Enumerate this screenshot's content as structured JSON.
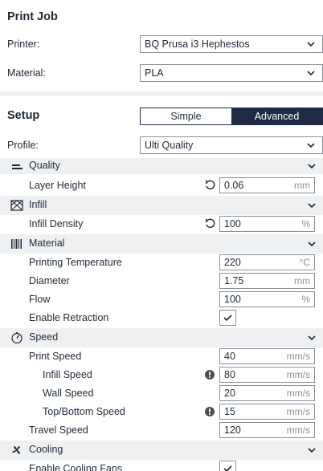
{
  "print_job": {
    "title": "Print Job",
    "printer_label": "Printer:",
    "printer_value": "BQ Prusa i3 Hephestos",
    "material_label": "Material:",
    "material_value": "PLA"
  },
  "setup": {
    "title": "Setup",
    "mode_simple": "Simple",
    "mode_advanced": "Advanced",
    "mode_selected": "Advanced",
    "profile_label": "Profile:",
    "profile_value": "Ulti Quality"
  },
  "categories": {
    "quality": {
      "label": "Quality",
      "icon": "quality-icon"
    },
    "infill": {
      "label": "Infill",
      "icon": "infill-icon"
    },
    "material": {
      "label": "Material",
      "icon": "material-icon"
    },
    "speed": {
      "label": "Speed",
      "icon": "speed-icon"
    },
    "cooling": {
      "label": "Cooling",
      "icon": "cooling-icon"
    }
  },
  "settings": {
    "layer_height": {
      "label": "Layer Height",
      "value": "0.06",
      "unit": "mm"
    },
    "infill_density": {
      "label": "Infill Density",
      "value": "100",
      "unit": "%"
    },
    "printing_temperature": {
      "label": "Printing Temperature",
      "value": "220",
      "unit": "°C"
    },
    "diameter": {
      "label": "Diameter",
      "value": "1.75",
      "unit": "mm"
    },
    "flow": {
      "label": "Flow",
      "value": "100",
      "unit": "%"
    },
    "enable_retraction": {
      "label": "Enable Retraction",
      "checked": true
    },
    "print_speed": {
      "label": "Print Speed",
      "value": "40",
      "unit": "mm/s"
    },
    "infill_speed": {
      "label": "Infill Speed",
      "value": "80",
      "unit": "mm/s"
    },
    "wall_speed": {
      "label": "Wall Speed",
      "value": "20",
      "unit": "mm/s"
    },
    "top_bottom_speed": {
      "label": "Top/Bottom Speed",
      "value": "15",
      "unit": "mm/s"
    },
    "travel_speed": {
      "label": "Travel Speed",
      "value": "120",
      "unit": "mm/s"
    },
    "enable_cooling_fans": {
      "label": "Enable Cooling Fans",
      "checked": true
    }
  },
  "colors": {
    "accent": "#1f2a45",
    "category_bg": "#eff0f1",
    "text": "#1f2a37",
    "unit_text": "#8a8f96"
  }
}
